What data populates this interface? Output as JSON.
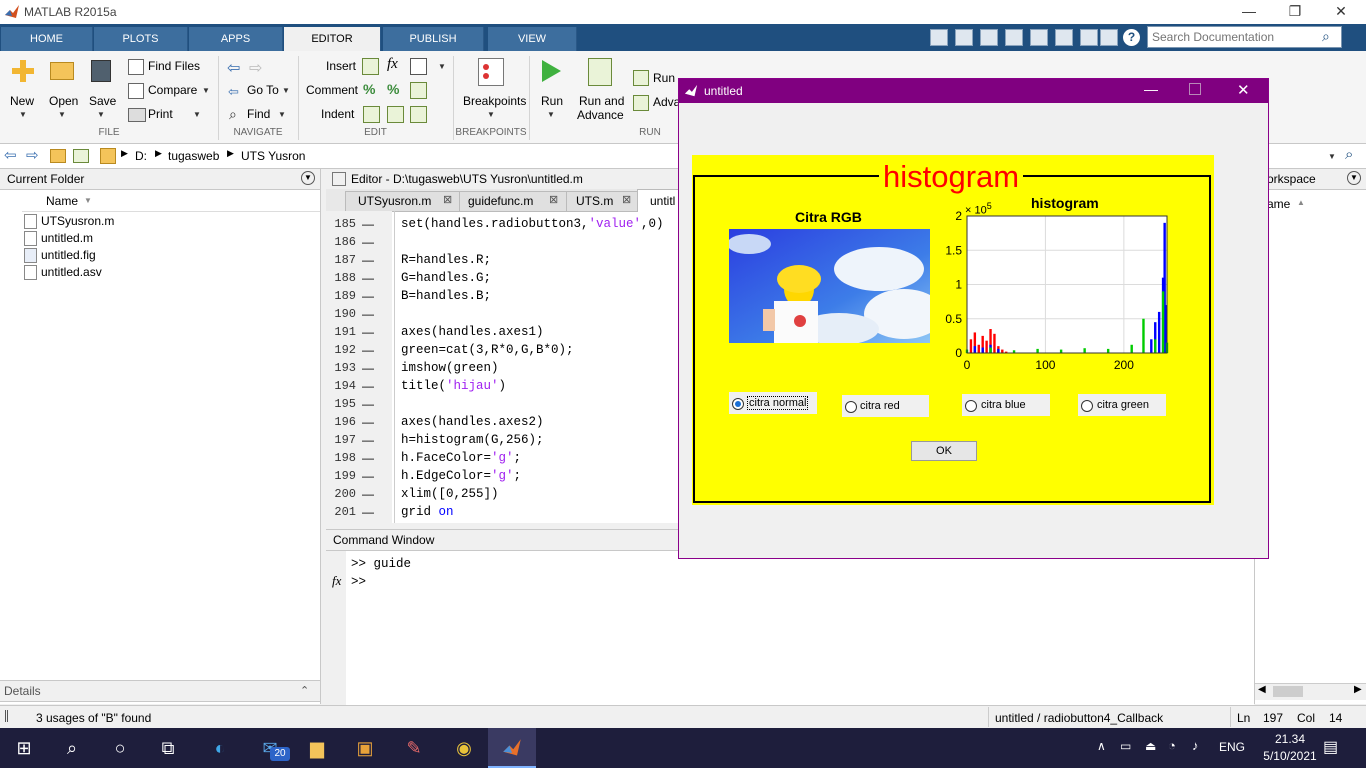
{
  "app": {
    "title": "MATLAB R2015a"
  },
  "window_controls": {
    "minimize": "—",
    "restore": "❐",
    "close": "✕"
  },
  "tabs": [
    {
      "label": "HOME"
    },
    {
      "label": "PLOTS"
    },
    {
      "label": "APPS"
    },
    {
      "label": "EDITOR"
    },
    {
      "label": "PUBLISH"
    },
    {
      "label": "VIEW"
    }
  ],
  "search": {
    "placeholder": "Search Documentation"
  },
  "ribbon": {
    "file": {
      "new": "New",
      "open": "Open",
      "save": "Save",
      "find_files": "Find Files",
      "compare": "Compare",
      "print": "Print",
      "group": "FILE"
    },
    "navigate": {
      "go_to": "Go To",
      "find": "Find",
      "group": "NAVIGATE"
    },
    "edit": {
      "insert": "Insert",
      "comment": "Comment",
      "indent": "Indent",
      "group": "EDIT"
    },
    "breakpoints": {
      "label": "Breakpoints",
      "group": "BREAKPOINTS"
    },
    "run": {
      "run": "Run",
      "run_advance_1": "Run and",
      "run_advance_2": "Advance",
      "run_section": "Run Section",
      "advance": "Adva",
      "group": "RUN"
    }
  },
  "address": {
    "crumbs": [
      "D:",
      "tugasweb",
      "UTS Yusron"
    ]
  },
  "current_folder": {
    "title": "Current Folder",
    "column": "Name",
    "files": [
      {
        "name": "UTSyusron.m"
      },
      {
        "name": "untitled.m"
      },
      {
        "name": "untitled.fig"
      },
      {
        "name": "untitled.asv"
      }
    ],
    "details": "Details"
  },
  "editor": {
    "title": "Editor - D:\\tugasweb\\UTS Yusron\\untitled.m",
    "tabs": [
      "UTSyusron.m",
      "guidefunc.m",
      "UTS.m",
      "untitl"
    ],
    "lines": [
      {
        "n": "185",
        "code": "set(handles.radiobutton3,'value',0)"
      },
      {
        "n": "186",
        "code": ""
      },
      {
        "n": "187",
        "code": "R=handles.R;"
      },
      {
        "n": "188",
        "code": "G=handles.G;"
      },
      {
        "n": "189",
        "code": "B=handles.B;"
      },
      {
        "n": "190",
        "code": ""
      },
      {
        "n": "191",
        "code": "axes(handles.axes1)"
      },
      {
        "n": "192",
        "code": "green=cat(3,R*0,G,B*0);"
      },
      {
        "n": "193",
        "code": "imshow(green)"
      },
      {
        "n": "194",
        "code": "title('hijau')"
      },
      {
        "n": "195",
        "code": ""
      },
      {
        "n": "196",
        "code": "axes(handles.axes2)"
      },
      {
        "n": "197",
        "code": "h=histogram(G,256);"
      },
      {
        "n": "198",
        "code": "h.FaceColor='g';"
      },
      {
        "n": "199",
        "code": "h.EdgeColor='g';"
      },
      {
        "n": "200",
        "code": "xlim([0,255])"
      },
      {
        "n": "201",
        "code": "grid on"
      }
    ]
  },
  "command_window": {
    "title": "Command Window",
    "line1": ">> guide",
    "line2": ">>",
    "fx": "fx"
  },
  "workspace": {
    "title": "orkspace",
    "column": "ame"
  },
  "status": {
    "message": "3 usages of \"B\" found",
    "callback": "untitled / radiobutton4_Callback",
    "ln_label": "Ln",
    "ln": "197",
    "col_label": "Col",
    "col": "14"
  },
  "figure": {
    "title": "untitled",
    "panel_title": "histogram",
    "image_title": "Citra RGB",
    "hist_title": "histogram",
    "exponent": "× 10",
    "exponent_power": "5",
    "radios": [
      {
        "label": "citra normal",
        "selected": true
      },
      {
        "label": "citra red",
        "selected": false
      },
      {
        "label": "citra blue",
        "selected": false
      },
      {
        "label": "citra green",
        "selected": false
      }
    ],
    "ok": "OK",
    "colors": {
      "panel": "#ffff00",
      "title_text": "#ff0000",
      "titlebar": "#800080"
    }
  },
  "chart_data": {
    "type": "bar",
    "title": "histogram",
    "xlim": [
      0,
      255
    ],
    "ylim": [
      0,
      200000
    ],
    "y_exponent": "× 10^5",
    "xticks": [
      "0",
      "100",
      "200"
    ],
    "yticks": [
      "0",
      "0.5",
      "1",
      "1.5",
      "2"
    ],
    "grid": true,
    "series": [
      {
        "name": "",
        "color": "#ff0000",
        "x": [
          5,
          10,
          15,
          20,
          25,
          30,
          35,
          40,
          45,
          50
        ],
        "values": [
          20000,
          30000,
          12000,
          25000,
          18000,
          35000,
          28000,
          10000,
          5000,
          2000
        ]
      },
      {
        "name": "",
        "color": "#0000ff",
        "x": [
          10,
          20,
          30,
          40,
          235,
          240,
          245,
          250,
          252,
          254
        ],
        "values": [
          10000,
          8000,
          12000,
          6000,
          20000,
          45000,
          60000,
          110000,
          190000,
          70000
        ]
      },
      {
        "name": "",
        "color": "#00cc00",
        "x": [
          0,
          30,
          60,
          90,
          120,
          150,
          180,
          210,
          225,
          240,
          250,
          255
        ],
        "values": [
          5000,
          8000,
          4000,
          6000,
          5000,
          7000,
          6000,
          12000,
          50000,
          20000,
          90000,
          15000
        ]
      }
    ]
  },
  "taskbar": {
    "time": "21.34",
    "date": "5/10/2021",
    "lang": "ENG",
    "mail_badge": "20"
  }
}
